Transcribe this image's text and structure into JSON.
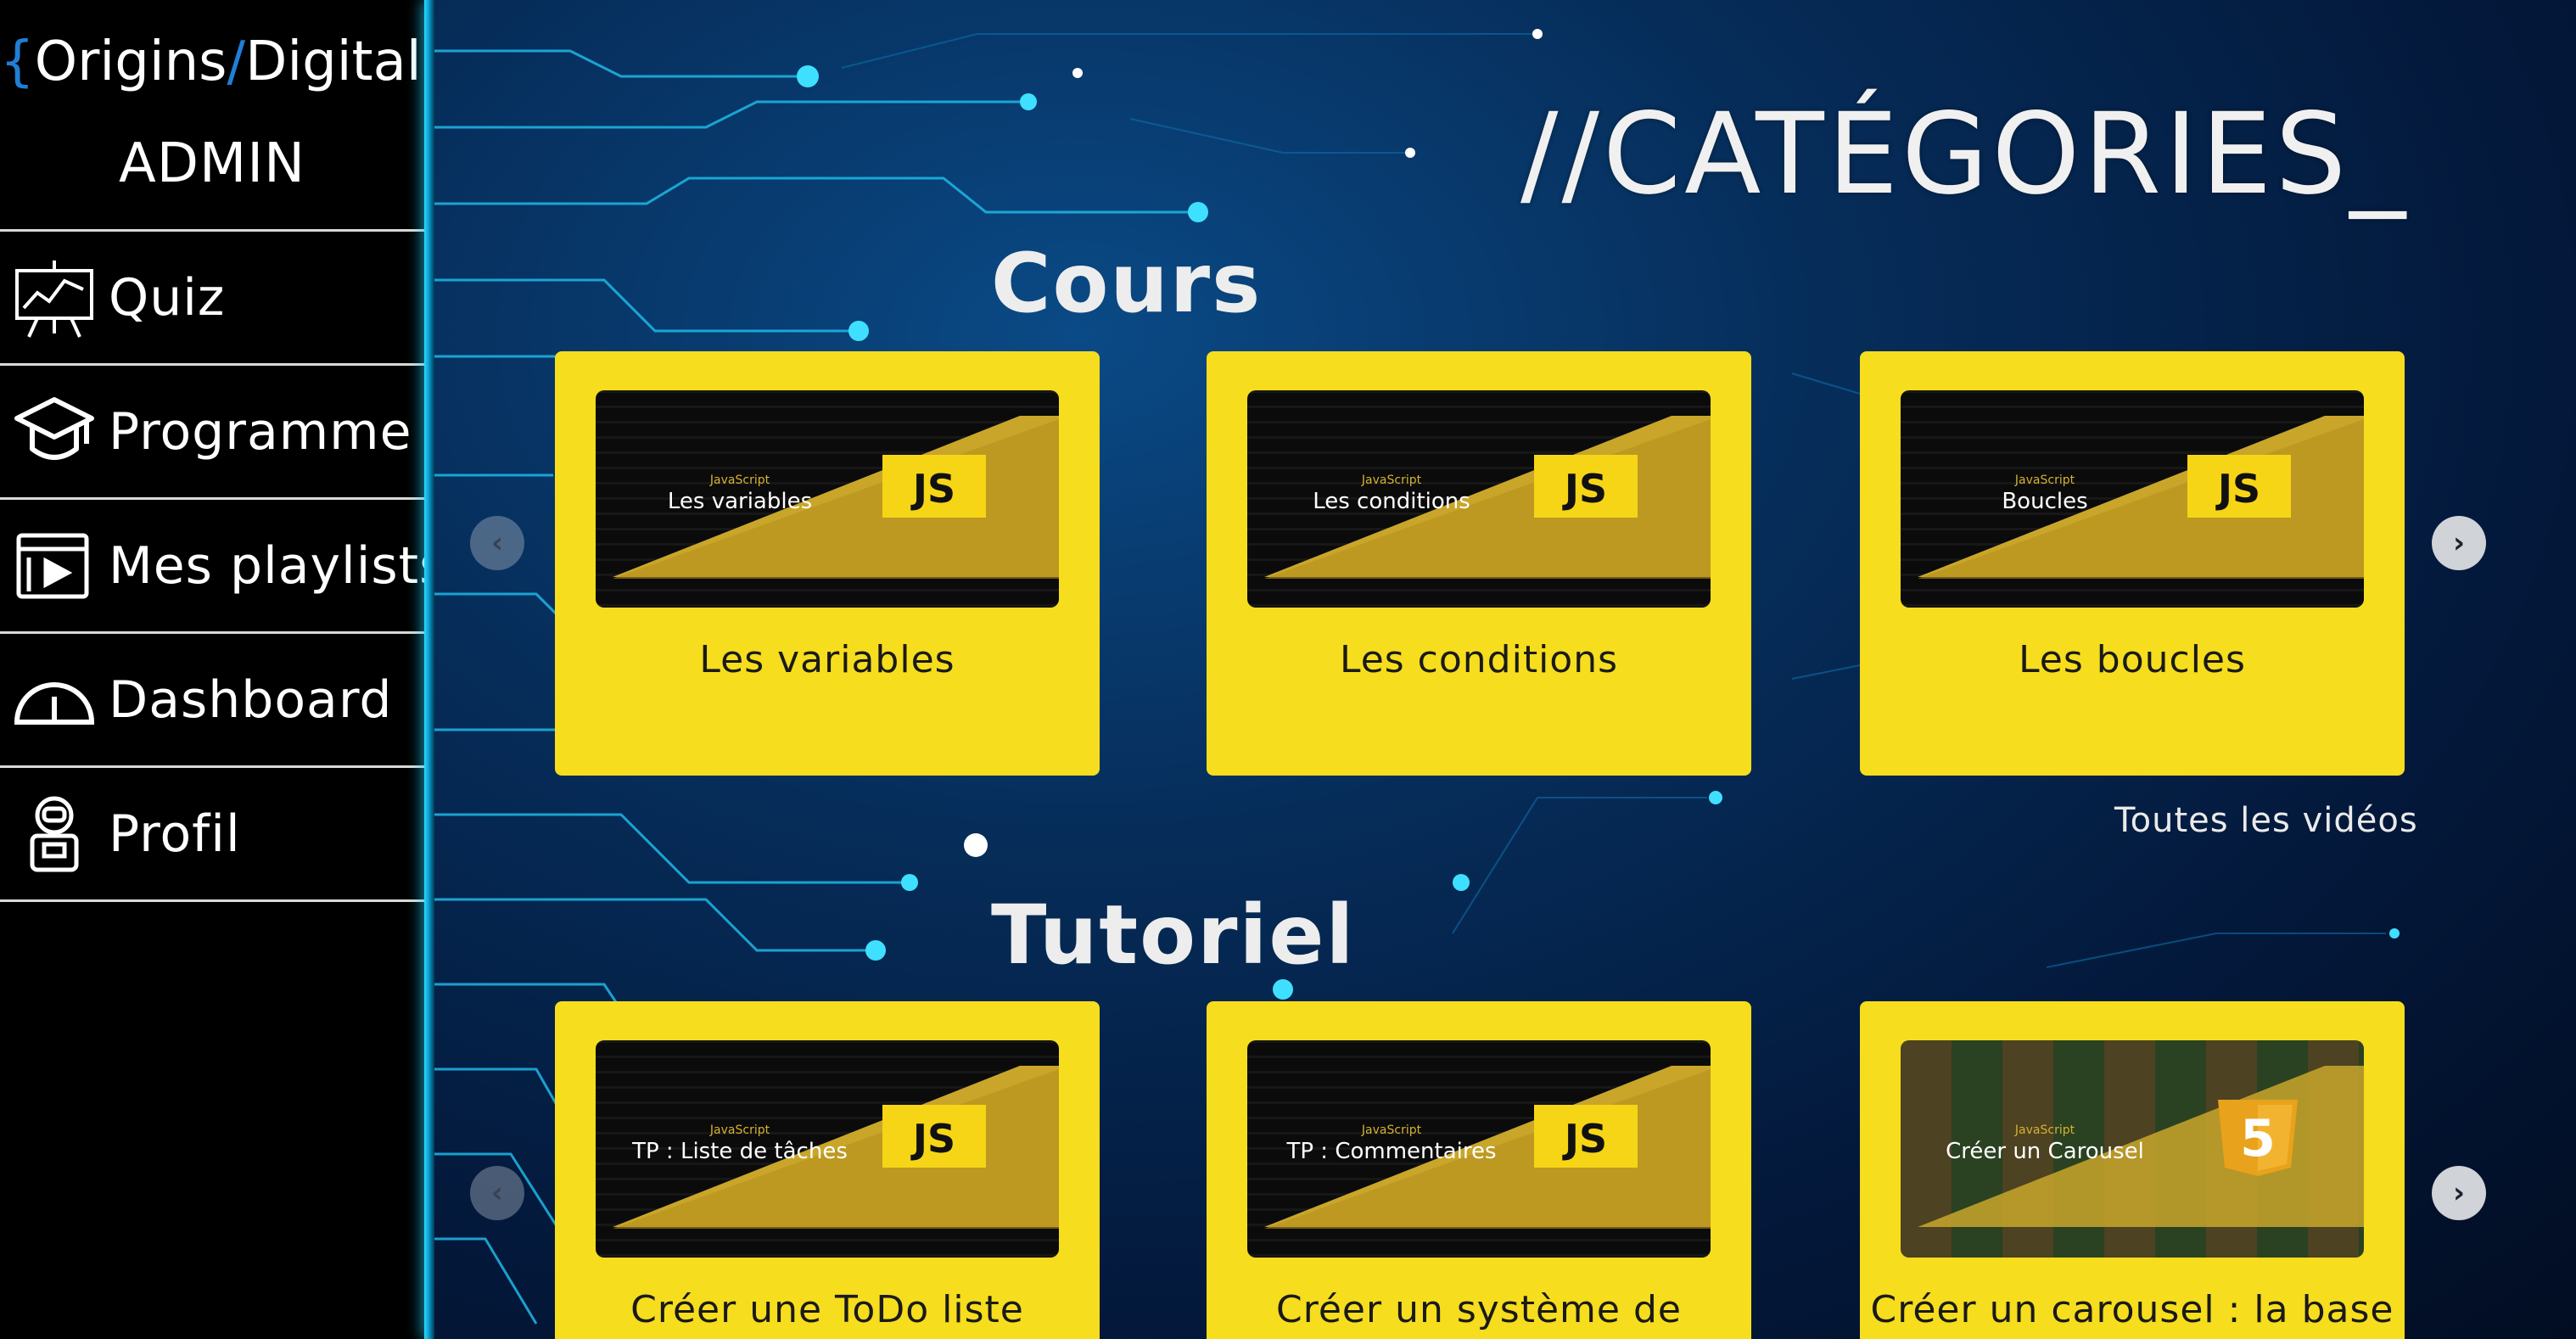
{
  "brand": {
    "open": "{",
    "word1": "Origins",
    "slash": "/",
    "word2": "Digital",
    "close": "}"
  },
  "role": "ADMIN",
  "menu": [
    {
      "label": "Quiz",
      "icon": "presentation-chart-icon"
    },
    {
      "label": "Programme",
      "icon": "graduation-cap-icon"
    },
    {
      "label": "Mes playlists",
      "icon": "video-playlist-icon"
    },
    {
      "label": "Dashboard",
      "icon": "gauge-icon"
    },
    {
      "label": "Profil",
      "icon": "astronaut-icon"
    }
  ],
  "page_title": "//CATÉGORIES_",
  "sections": [
    {
      "title": "Cours",
      "all_link": "Toutes les vidéos",
      "cards": [
        {
          "thumb_sub": "JavaScript",
          "thumb_title": "Les variables",
          "badge": "JS",
          "title": "Les variables"
        },
        {
          "thumb_sub": "JavaScript",
          "thumb_title": "Les conditions",
          "badge": "JS",
          "title": "Les conditions"
        },
        {
          "thumb_sub": "JavaScript",
          "thumb_title": "Boucles",
          "badge": "JS",
          "title": "Les boucles"
        }
      ]
    },
    {
      "title": "Tutoriel",
      "cards": [
        {
          "thumb_sub": "JavaScript",
          "thumb_title": "TP : Liste de tâches",
          "badge": "JS",
          "title": "Créer une ToDo liste"
        },
        {
          "thumb_sub": "JavaScript",
          "thumb_title": "TP : Commentaires",
          "badge": "JS",
          "title": "Créer un système de"
        },
        {
          "thumb_sub": "JavaScript",
          "thumb_title": "Créer un Carousel",
          "badge": "5",
          "title": "Créer un carousel : la base"
        }
      ]
    }
  ],
  "carousel": {
    "prev": "‹",
    "next": "›"
  },
  "colors": {
    "accent_yellow": "#f6dd1e",
    "brand_brace": "#1f7fd6",
    "neon": "#2fd8ff"
  }
}
